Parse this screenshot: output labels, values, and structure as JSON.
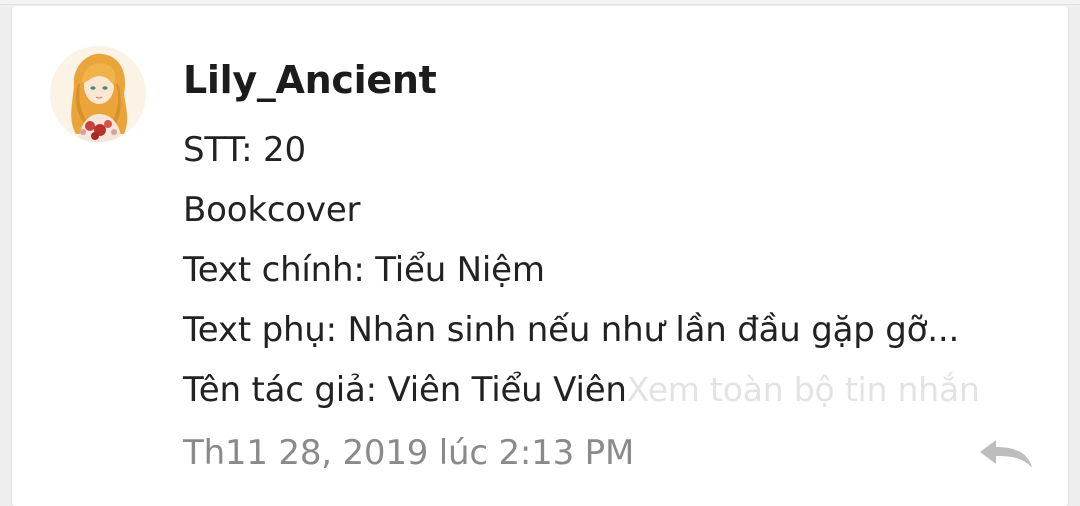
{
  "message": {
    "username": "Lily_Ancient",
    "lines": [
      "STT: 20",
      "Bookcover",
      "Text chính: Tiểu Niệm",
      "Text phụ: Nhân sinh nếu như lần đầu gặp gỡ...",
      "Tên tác giả: Viên Tiểu Viên"
    ],
    "more_link": "Xem toàn bộ tin nhắn",
    "timestamp": "Th11 28, 2019 lúc 2:13 PM",
    "avatar_icon": "user-avatar-image",
    "reply_icon": "reply-arrow-icon"
  },
  "colors": {
    "background": "#eeeeee",
    "card": "#ffffff",
    "text": "#222222",
    "timestamp": "#8a8a8a",
    "more_link": "#e3e3e3",
    "reply_icon": "#bdbdbd"
  }
}
